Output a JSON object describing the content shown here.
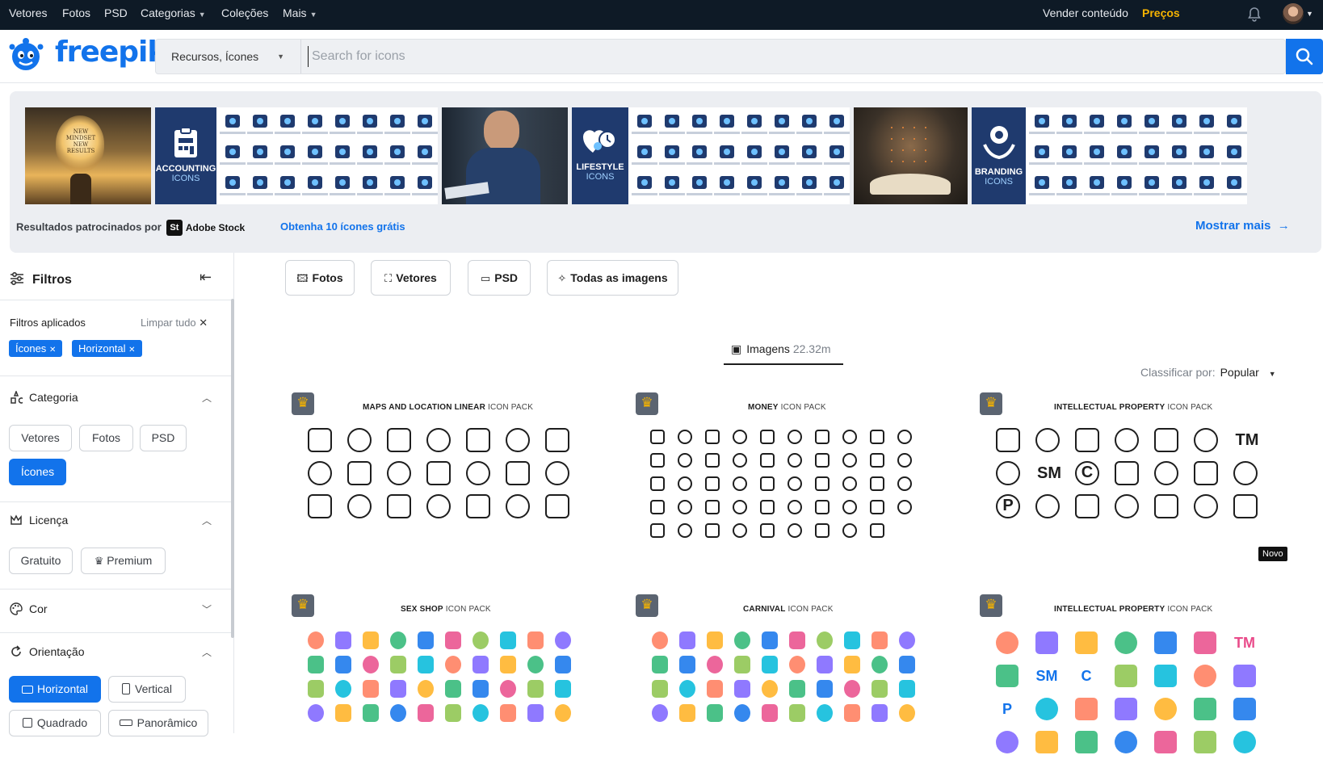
{
  "topnav": {
    "left": [
      "Vetores",
      "Fotos",
      "PSD",
      "Categorias",
      "Coleções",
      "Mais"
    ],
    "sell": "Vender conteúdo",
    "pricing": "Preços"
  },
  "logo": {
    "text": "freepik"
  },
  "search": {
    "type": "Recursos, Ícones",
    "placeholder": "Search for icons"
  },
  "banner": {
    "tiles": [
      {
        "kind": "photo",
        "label": "NEW MINDSET NEW RESULTS"
      },
      {
        "kind": "pack",
        "title": "ACCOUNTING",
        "sub": "ICONS"
      },
      {
        "kind": "photo",
        "label": ""
      },
      {
        "kind": "pack",
        "title": "LIFESTYLE",
        "sub": "ICONS"
      },
      {
        "kind": "photo",
        "label": ""
      },
      {
        "kind": "pack",
        "title": "BRANDING",
        "sub": "ICONS"
      }
    ],
    "sponsored": "Resultados patrocinados por",
    "adobe_badge": "St",
    "adobe_name": "Adobe Stock",
    "get_free": "Obtenha 10 ícones grátis",
    "show_more": "Mostrar mais"
  },
  "filters": {
    "title": "Filtros",
    "applied_label": "Filtros aplicados",
    "clear_all": "Limpar tudo",
    "chips": [
      "Ícones",
      "Horizontal"
    ],
    "category": {
      "title": "Categoria",
      "options": [
        "Vetores",
        "Fotos",
        "PSD",
        "Ícones"
      ],
      "selected": "Ícones"
    },
    "license": {
      "title": "Licença",
      "options": [
        "Gratuito",
        "Premium"
      ]
    },
    "color": {
      "title": "Cor"
    },
    "orientation": {
      "title": "Orientação",
      "options": [
        "Horizontal",
        "Vertical",
        "Quadrado",
        "Panorâmico"
      ],
      "selected": "Horizontal"
    }
  },
  "type_tabs": [
    "Fotos",
    "Vetores",
    "PSD",
    "Todas as imagens"
  ],
  "results": {
    "label": "Imagens",
    "count": "22.32m"
  },
  "sort": {
    "label": "Classificar por:",
    "value": "Popular"
  },
  "cards": [
    {
      "title": "MAPS AND LOCATION LINEAR",
      "suffix": "ICON PACK"
    },
    {
      "title": "MONEY",
      "suffix": "ICON PACK"
    },
    {
      "title": "INTELLECTUAL PROPERTY",
      "suffix": "ICON PACK",
      "badge": "Novo"
    },
    {
      "title": "SEX SHOP",
      "suffix": "ICON PACK"
    },
    {
      "title": "CARNIVAL",
      "suffix": "ICON PACK"
    },
    {
      "title": "INTELLECTUAL PROPERTY",
      "suffix": "ICON PACK"
    }
  ],
  "ip_glyphs": [
    "TM",
    "SM",
    "C",
    "P"
  ],
  "colors": {
    "brand": "#1273eb",
    "topbar": "#0e1a26",
    "premium": "#f5b301",
    "navy_pack": "#1f3a6e"
  }
}
